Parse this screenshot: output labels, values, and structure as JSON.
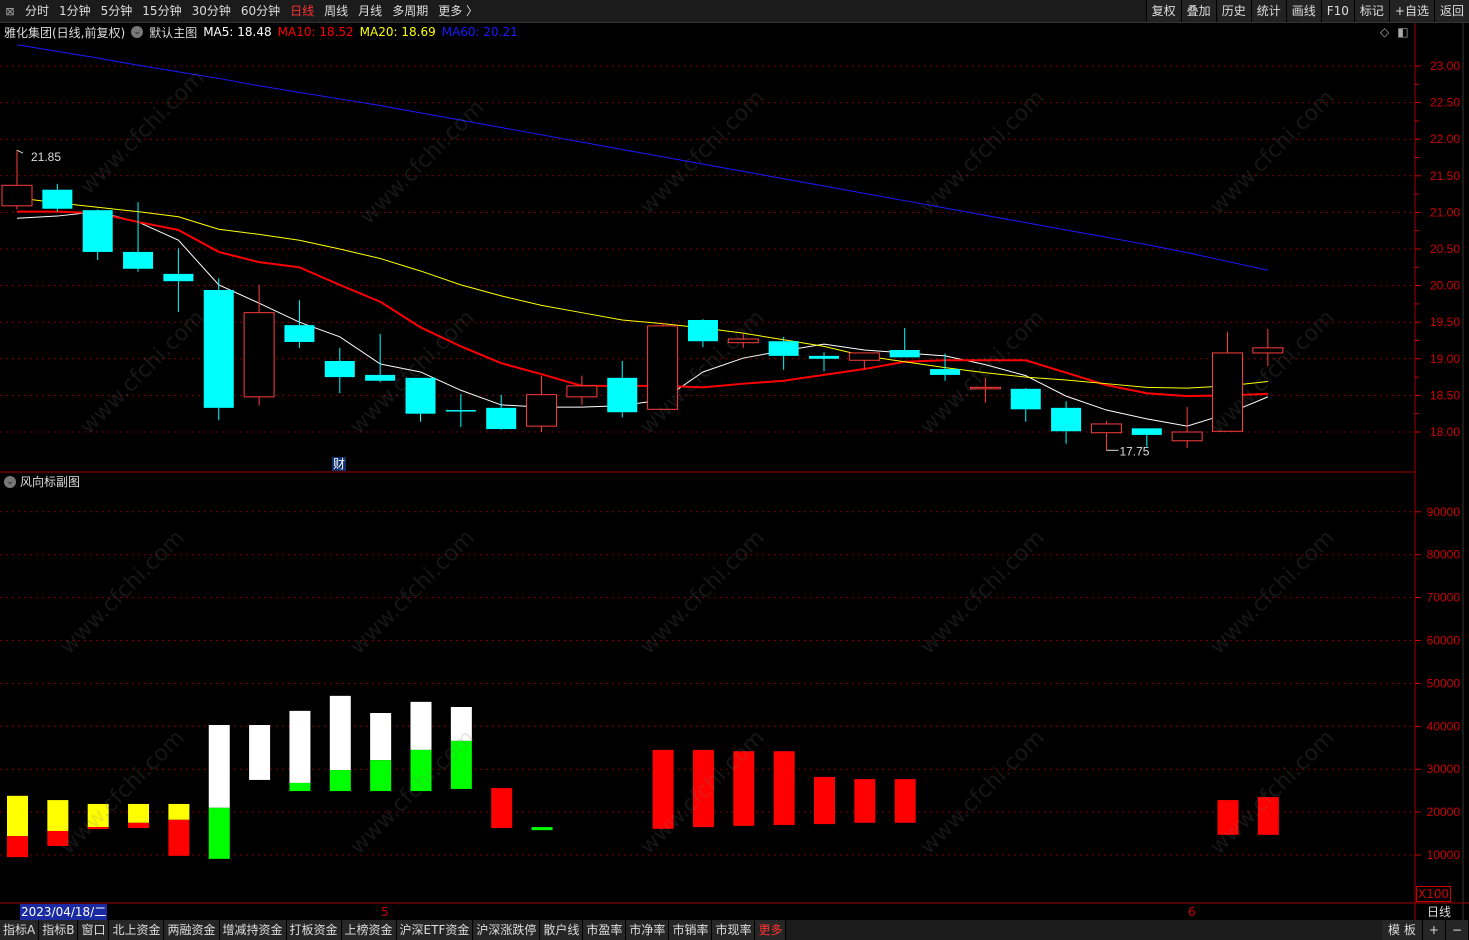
{
  "toolbar": {
    "periods": [
      {
        "label": "分时",
        "active": false
      },
      {
        "label": "1分钟",
        "active": false
      },
      {
        "label": "5分钟",
        "active": false
      },
      {
        "label": "15分钟",
        "active": false
      },
      {
        "label": "30分钟",
        "active": false
      },
      {
        "label": "60分钟",
        "active": false
      },
      {
        "label": "日线",
        "active": true
      },
      {
        "label": "周线",
        "active": false
      },
      {
        "label": "月线",
        "active": false
      },
      {
        "label": "多周期",
        "active": false
      },
      {
        "label": "更多 〉",
        "active": false
      }
    ],
    "right_buttons": [
      "复权",
      "叠加",
      "历史",
      "统计",
      "画线",
      "F10",
      "标记",
      "+自选",
      "返回"
    ]
  },
  "info": {
    "stock": "雅化集团(日线,前复权)",
    "main_chart": "默认主图",
    "ma5": "MA5: 18.48",
    "ma10": "MA10: 18.52",
    "ma20": "MA20: 18.69",
    "ma60": "MA60: 20.21"
  },
  "colors": {
    "up": "#ff3c3c",
    "down": "#00ffff",
    "ma5": "#ffffff",
    "ma10": "#ff0000",
    "ma20": "#ffff00",
    "ma60": "#1a1aff",
    "axis": "#cc0000",
    "grid": "#7a0000"
  },
  "annotations": {
    "high_label": "21.85",
    "low_label": "17.75",
    "finance_marker": "财"
  },
  "sub_chart": {
    "title": "风向标副图",
    "unit": "X100"
  },
  "date_bar": {
    "cursor_date": "2023/04/18/二",
    "month_marks": [
      {
        "label": "5",
        "index": 9
      },
      {
        "label": "6",
        "index": 29
      }
    ],
    "period": "日线"
  },
  "bottom_tabs": [
    "指标A",
    "指标B",
    "窗口",
    "北上资金",
    "两融资金",
    "增减持资金",
    "打板资金",
    "上榜资金",
    "沪深ETF资金",
    "沪深涨跌停",
    "散户线",
    "市盈率",
    "市净率",
    "市销率",
    "市现率",
    "更多"
  ],
  "bottom_right": [
    "模 板",
    "+",
    "−"
  ],
  "watermark": "www.cfchi.com",
  "chart_data": [
    {
      "type": "candlestick",
      "ylim": [
        17.6,
        23.3
      ],
      "yticks": [
        "18.00",
        "18.50",
        "19.00",
        "19.50",
        "20.00",
        "20.50",
        "21.00",
        "21.50",
        "22.00",
        "22.50",
        "23.00"
      ],
      "ohlc": [
        [
          21.09,
          21.85,
          21.04,
          21.37
        ],
        [
          21.31,
          21.39,
          21.01,
          21.05
        ],
        [
          21.03,
          21.04,
          20.35,
          20.46
        ],
        [
          20.46,
          21.14,
          20.19,
          20.23
        ],
        [
          20.16,
          20.51,
          19.64,
          20.06
        ],
        [
          19.94,
          20.1,
          18.16,
          18.33
        ],
        [
          18.48,
          20.01,
          18.36,
          19.63
        ],
        [
          19.46,
          19.8,
          19.15,
          19.23
        ],
        [
          18.97,
          19.15,
          18.53,
          18.75
        ],
        [
          18.78,
          19.34,
          18.68,
          18.7
        ],
        [
          18.74,
          18.74,
          18.14,
          18.25
        ],
        [
          18.3,
          18.52,
          18.07,
          18.29
        ],
        [
          18.33,
          18.51,
          18.03,
          18.04
        ],
        [
          18.08,
          18.77,
          18.0,
          18.51
        ],
        [
          18.48,
          18.77,
          18.37,
          18.63
        ],
        [
          18.74,
          18.97,
          18.2,
          18.27
        ],
        [
          18.31,
          19.49,
          18.31,
          19.45
        ],
        [
          19.53,
          19.54,
          19.16,
          19.24
        ],
        [
          19.22,
          19.34,
          19.15,
          19.27
        ],
        [
          19.24,
          19.3,
          18.85,
          19.04
        ],
        [
          19.04,
          19.09,
          18.83,
          19.0
        ],
        [
          18.98,
          19.08,
          18.85,
          19.08
        ],
        [
          19.12,
          19.42,
          19.02,
          19.02
        ],
        [
          18.86,
          19.07,
          18.7,
          18.78
        ],
        [
          18.59,
          18.74,
          18.4,
          18.61
        ],
        [
          18.59,
          18.6,
          18.14,
          18.31
        ],
        [
          18.33,
          18.42,
          17.84,
          18.01
        ],
        [
          17.99,
          18.15,
          17.75,
          18.11
        ],
        [
          18.05,
          18.05,
          17.8,
          17.96
        ],
        [
          17.88,
          18.34,
          17.78,
          18.0
        ],
        [
          18.01,
          19.37,
          18.01,
          19.08
        ],
        [
          19.08,
          19.41,
          18.9,
          19.15
        ]
      ],
      "series": [
        {
          "name": "MA5",
          "values": [
            20.92,
            20.95,
            21.01,
            20.87,
            20.62,
            20.01,
            19.76,
            19.5,
            19.3,
            18.93,
            18.82,
            18.57,
            18.37,
            18.34,
            18.34,
            18.36,
            18.44,
            18.82,
            19.01,
            19.11,
            19.2,
            19.12,
            19.08,
            19.04,
            18.92,
            18.77,
            18.49,
            18.3,
            18.18,
            18.08,
            18.25,
            18.48
          ]
        },
        {
          "name": "MA10",
          "values": [
            21.01,
            21.01,
            20.99,
            20.87,
            20.76,
            20.46,
            20.32,
            20.25,
            20.01,
            19.78,
            19.43,
            19.17,
            18.94,
            18.79,
            18.63,
            18.63,
            18.63,
            18.61,
            18.66,
            18.7,
            18.78,
            18.86,
            18.96,
            18.98,
            18.98,
            18.98,
            18.81,
            18.64,
            18.53,
            18.49,
            18.5,
            18.52
          ]
        },
        {
          "name": "MA20",
          "values": [
            21.2,
            21.13,
            21.07,
            21.01,
            20.94,
            20.77,
            20.7,
            20.62,
            20.5,
            20.37,
            20.2,
            20.01,
            19.86,
            19.73,
            19.63,
            19.53,
            19.48,
            19.42,
            19.35,
            19.26,
            19.17,
            19.04,
            18.96,
            18.88,
            18.81,
            18.75,
            18.71,
            18.66,
            18.61,
            18.6,
            18.63,
            18.69
          ]
        },
        {
          "name": "MA60",
          "values": [
            23.29,
            23.2,
            23.11,
            23.01,
            22.92,
            22.83,
            22.73,
            22.64,
            22.55,
            22.46,
            22.36,
            22.26,
            22.16,
            22.06,
            21.96,
            21.86,
            21.76,
            21.66,
            21.56,
            21.46,
            21.36,
            21.26,
            21.16,
            21.06,
            20.96,
            20.86,
            20.76,
            20.66,
            20.56,
            20.45,
            20.33,
            20.21
          ]
        }
      ]
    },
    {
      "type": "bar",
      "title": "风向标副图",
      "ylim": [
        6000,
        96000
      ],
      "yticks": [
        "10000",
        "20000",
        "30000",
        "40000",
        "50000",
        "60000",
        "70000",
        "80000",
        "90000"
      ],
      "bars": [
        [
          [
            23800,
            14400,
            "yellow"
          ],
          [
            14400,
            9500,
            "red"
          ]
        ],
        [
          [
            22800,
            15600,
            "yellow"
          ],
          [
            15600,
            12100,
            "red"
          ]
        ],
        [
          [
            21900,
            16500,
            "yellow"
          ],
          [
            16500,
            16300,
            "red"
          ]
        ],
        [
          [
            21900,
            17500,
            "yellow"
          ],
          [
            17500,
            16300,
            "red"
          ]
        ],
        [
          [
            21900,
            18200,
            "yellow"
          ],
          [
            18200,
            9800,
            "red"
          ]
        ],
        [
          [
            40300,
            21000,
            "white"
          ],
          [
            21000,
            9100,
            "green"
          ]
        ],
        [
          [
            40300,
            27500,
            "white"
          ]
        ],
        [
          [
            43600,
            26800,
            "white"
          ],
          [
            26800,
            24900,
            "green"
          ]
        ],
        [
          [
            47100,
            29800,
            "white"
          ],
          [
            29800,
            24900,
            "green"
          ]
        ],
        [
          [
            43100,
            32100,
            "white"
          ],
          [
            32100,
            24900,
            "green"
          ]
        ],
        [
          [
            45700,
            34500,
            "white"
          ],
          [
            34500,
            24900,
            "green"
          ]
        ],
        [
          [
            44500,
            36600,
            "white"
          ],
          [
            36600,
            25400,
            "green"
          ]
        ],
        [
          [
            25600,
            16300,
            "red"
          ]
        ],
        [
          [
            16500,
            15800,
            "green"
          ]
        ],
        [],
        [],
        [
          [
            34500,
            16100,
            "red"
          ]
        ],
        [
          [
            34500,
            16500,
            "red"
          ]
        ],
        [
          [
            34200,
            16800,
            "red"
          ]
        ],
        [
          [
            34200,
            17000,
            "red"
          ]
        ],
        [
          [
            28200,
            17200,
            "red"
          ]
        ],
        [
          [
            27700,
            17500,
            "red"
          ]
        ],
        [
          [
            27700,
            17500,
            "red"
          ]
        ],
        [],
        [],
        [],
        [],
        [],
        [],
        [],
        [
          [
            22800,
            14700,
            "red"
          ]
        ],
        [
          [
            23500,
            14700,
            "red"
          ]
        ]
      ]
    }
  ]
}
